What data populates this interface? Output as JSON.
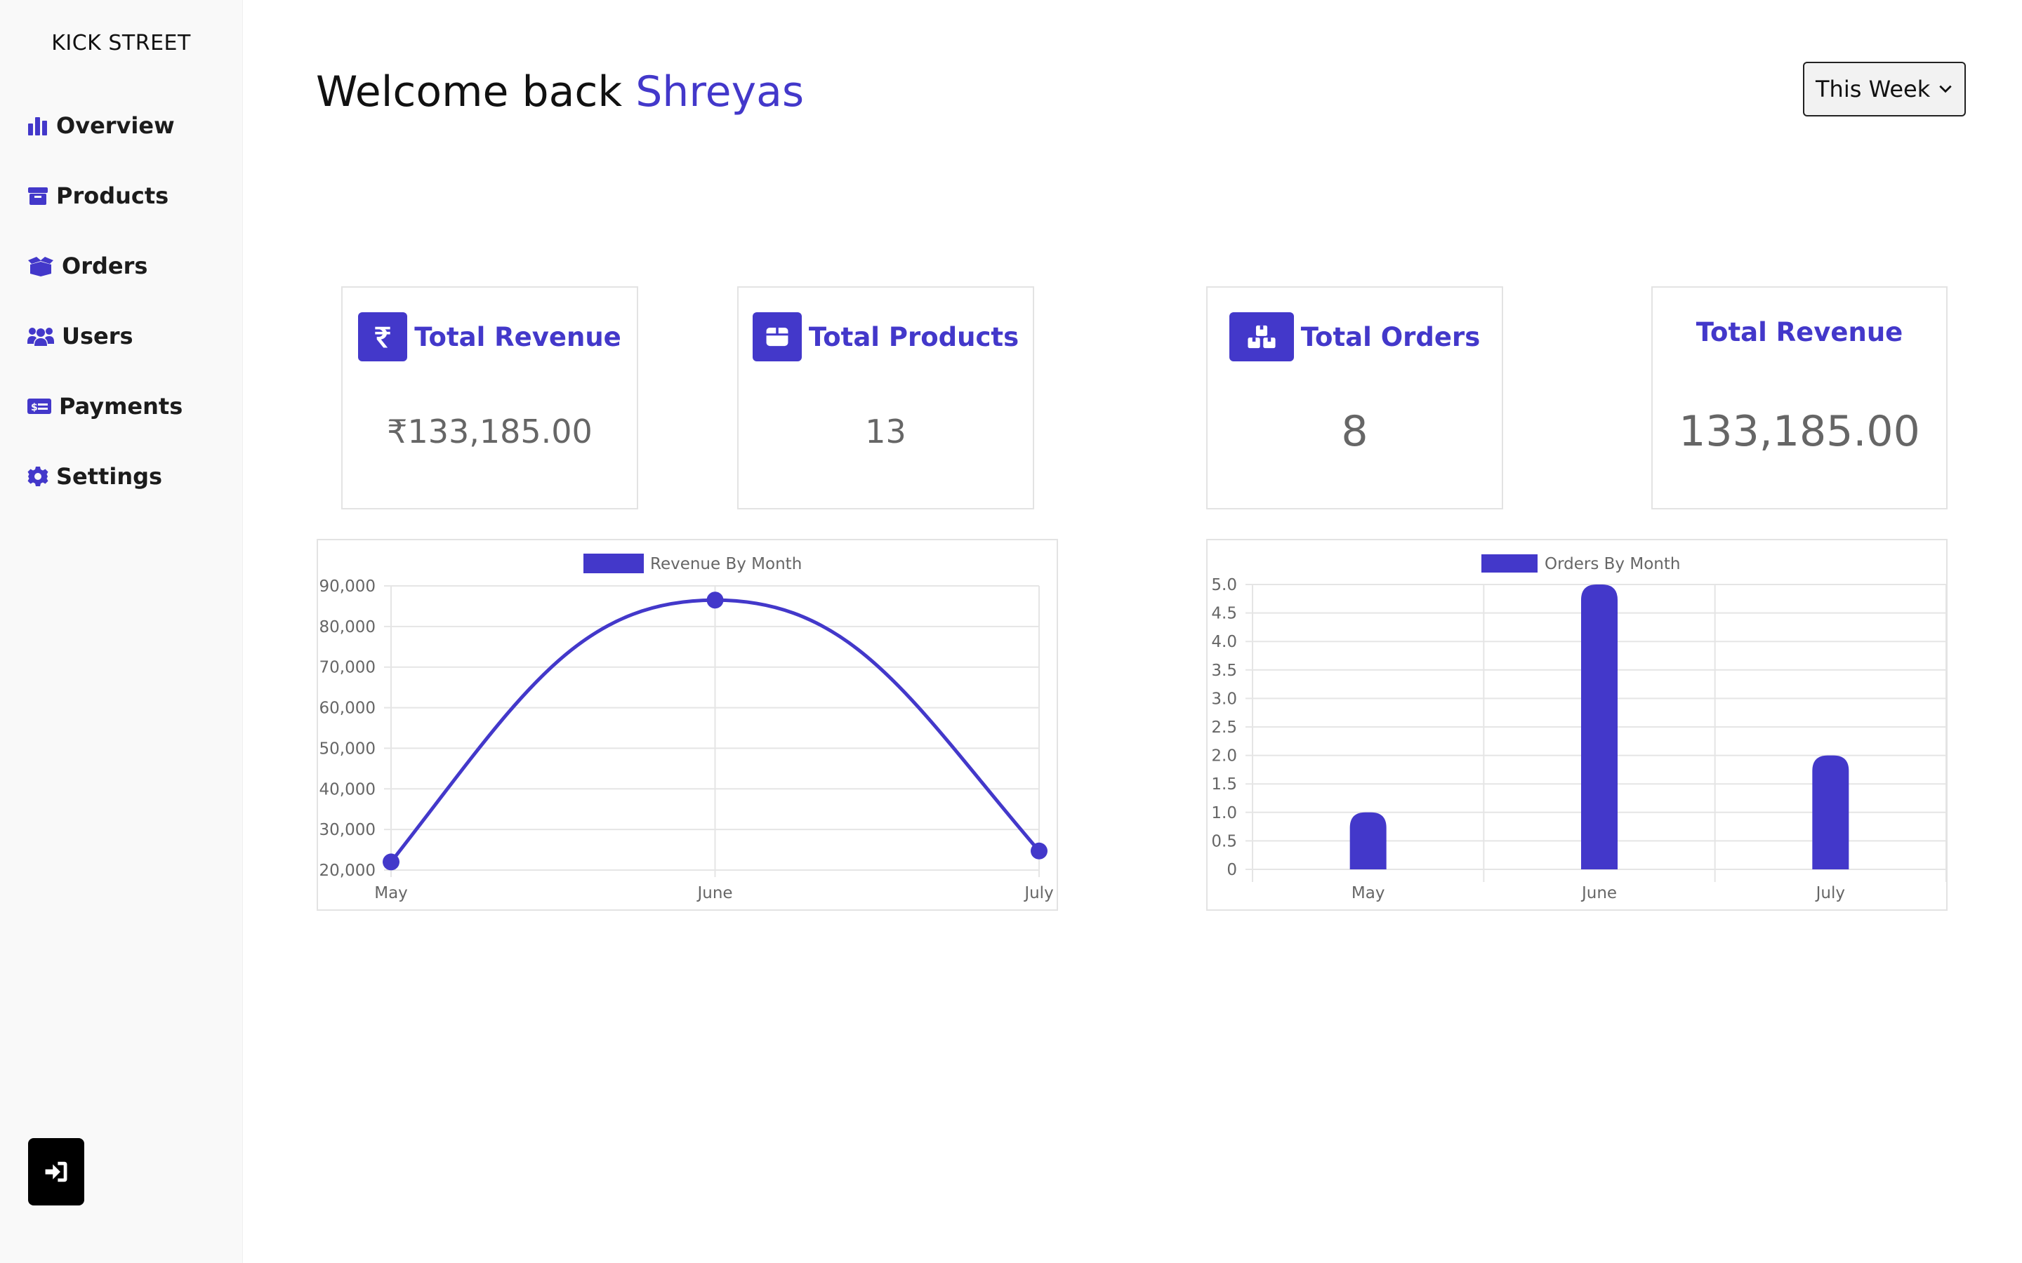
{
  "brand": "KICK STREET",
  "nav": [
    {
      "label": "Overview",
      "icon": "chart-bar-icon"
    },
    {
      "label": "Products",
      "icon": "box-icon"
    },
    {
      "label": "Orders",
      "icon": "box-open-icon"
    },
    {
      "label": "Users",
      "icon": "users-icon"
    },
    {
      "label": "Payments",
      "icon": "money-check-icon"
    },
    {
      "label": "Settings",
      "icon": "gear-icon"
    }
  ],
  "logout": {
    "icon": "logout-icon"
  },
  "header": {
    "greeting": "Welcome back",
    "user_name": "Shreyas"
  },
  "period_select": {
    "value": "This Week"
  },
  "cards": [
    {
      "title": "Total Revenue",
      "value": "₹133,185.00",
      "icon": "rupee-icon"
    },
    {
      "title": "Total Products",
      "value": "13",
      "icon": "box-icon"
    },
    {
      "title": "Total Orders",
      "value": "8",
      "icon": "boxes-stacked-icon"
    },
    {
      "title": "Total Revenue",
      "value": "133,185.00"
    }
  ],
  "colors": {
    "accent": "#4338ca"
  },
  "chart_data": [
    {
      "type": "line",
      "categories": [
        "May",
        "June",
        "July"
      ],
      "series": [
        {
          "name": "Revenue By Month",
          "values": [
            22000,
            86500,
            24700
          ]
        }
      ],
      "ylim": [
        20000,
        90000
      ],
      "yticks": [
        "90,000",
        "80,000",
        "70,000",
        "60,000",
        "50,000",
        "40,000",
        "30,000",
        "20,000"
      ],
      "legend": "top",
      "grid": true
    },
    {
      "type": "bar",
      "categories": [
        "May",
        "June",
        "July"
      ],
      "series": [
        {
          "name": "Orders By Month",
          "values": [
            1,
            5,
            2
          ]
        }
      ],
      "ylim": [
        0,
        5
      ],
      "yticks": [
        "5.0",
        "4.5",
        "4.0",
        "3.5",
        "3.0",
        "2.5",
        "2.0",
        "1.5",
        "1.0",
        "0.5",
        "0"
      ],
      "legend": "top",
      "grid": true
    }
  ]
}
